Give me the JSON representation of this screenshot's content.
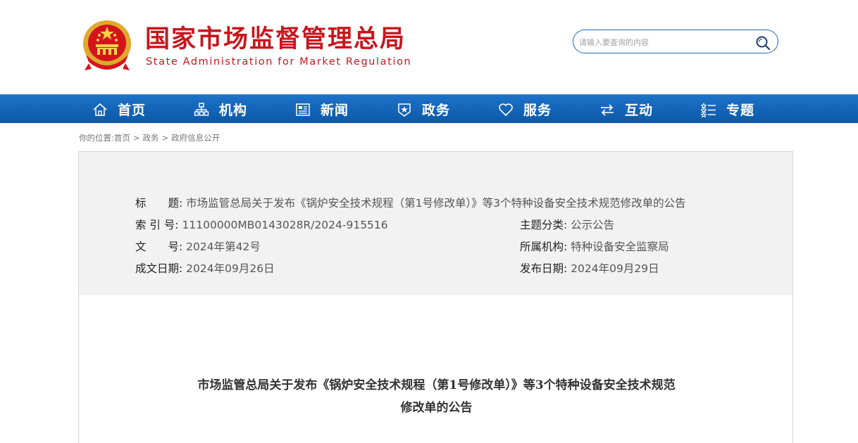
{
  "header": {
    "title": "国家市场监督管理总局",
    "subtitle": "State Administration for Market Regulation",
    "search": {
      "placeholder": "请输入要查询的内容",
      "value": ""
    }
  },
  "nav": {
    "items": [
      {
        "label": "首页",
        "icon": "home-icon"
      },
      {
        "label": "机构",
        "icon": "org-chart-icon"
      },
      {
        "label": "新闻",
        "icon": "newspaper-icon"
      },
      {
        "label": "政务",
        "icon": "badge-star-icon"
      },
      {
        "label": "服务",
        "icon": "heart-icon"
      },
      {
        "label": "互动",
        "icon": "swap-arrows-icon"
      },
      {
        "label": "专题",
        "icon": "topic-list-icon"
      }
    ]
  },
  "breadcrumb": {
    "prefix": "你的位置:",
    "items": [
      "首页",
      "政务",
      "政府信息公开"
    ],
    "separator": ">"
  },
  "info": {
    "title_label": "标　　题:",
    "title_value": "市场监管总局关于发布《锅炉安全技术规程（第1号修改单）》等3个特种设备安全技术规范修改单的公告",
    "index_label": "索 引 号:",
    "index_value": "11100000MB0143028R/2024-915516",
    "category_label": "主题分类:",
    "category_value": "公示公告",
    "doc_no_label": "文　　号:",
    "doc_no_value": "2024年第42号",
    "org_label": "所属机构:",
    "org_value": "特种设备安全监察局",
    "created_label": "成文日期:",
    "created_value": "2024年09月26日",
    "published_label": "发布日期:",
    "published_value": "2024年09月29日"
  },
  "article": {
    "title_line1": "市场监管总局关于发布《锅炉安全技术规程（第1号修改单）》等3个特种设备安全技术规范",
    "title_line2": "修改单的公告"
  },
  "colors": {
    "brand_red": "#c8161d",
    "nav_blue": "#0f5fb0",
    "search_border": "#1f67b8"
  }
}
